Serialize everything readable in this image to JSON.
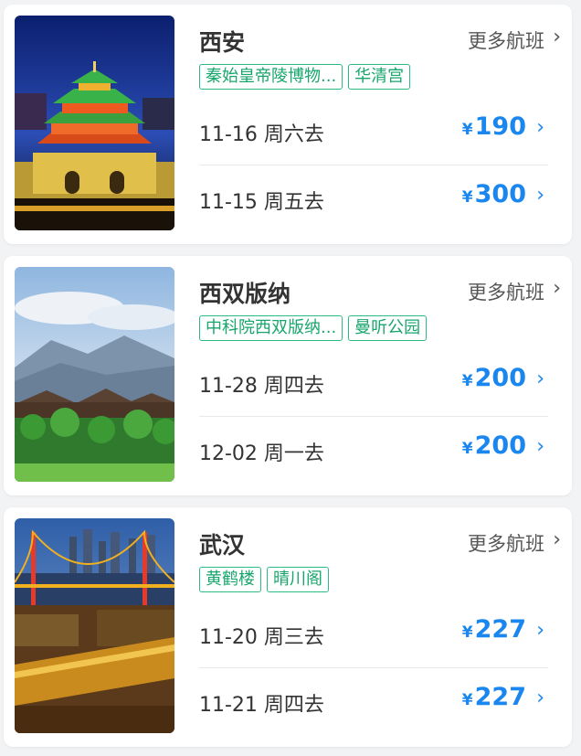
{
  "more_label": "更多航班",
  "chevron": "›",
  "currency": "¥",
  "accent_color": "#1a86ef",
  "tag_color": "#19a66d",
  "cards": [
    {
      "city": "西安",
      "tags": [
        "秦始皇帝陵博物...",
        "华清宫"
      ],
      "flights": [
        {
          "date": "11-16 周六去",
          "price": "190"
        },
        {
          "date": "11-15 周五去",
          "price": "300"
        }
      ]
    },
    {
      "city": "西双版纳",
      "tags": [
        "中科院西双版纳...",
        "曼听公园"
      ],
      "flights": [
        {
          "date": "11-28 周四去",
          "price": "200"
        },
        {
          "date": "12-02 周一去",
          "price": "200"
        }
      ]
    },
    {
      "city": "武汉",
      "tags": [
        "黄鹤楼",
        "晴川阁"
      ],
      "flights": [
        {
          "date": "11-20 周三去",
          "price": "227"
        },
        {
          "date": "11-21 周四去",
          "price": "227"
        }
      ]
    }
  ]
}
